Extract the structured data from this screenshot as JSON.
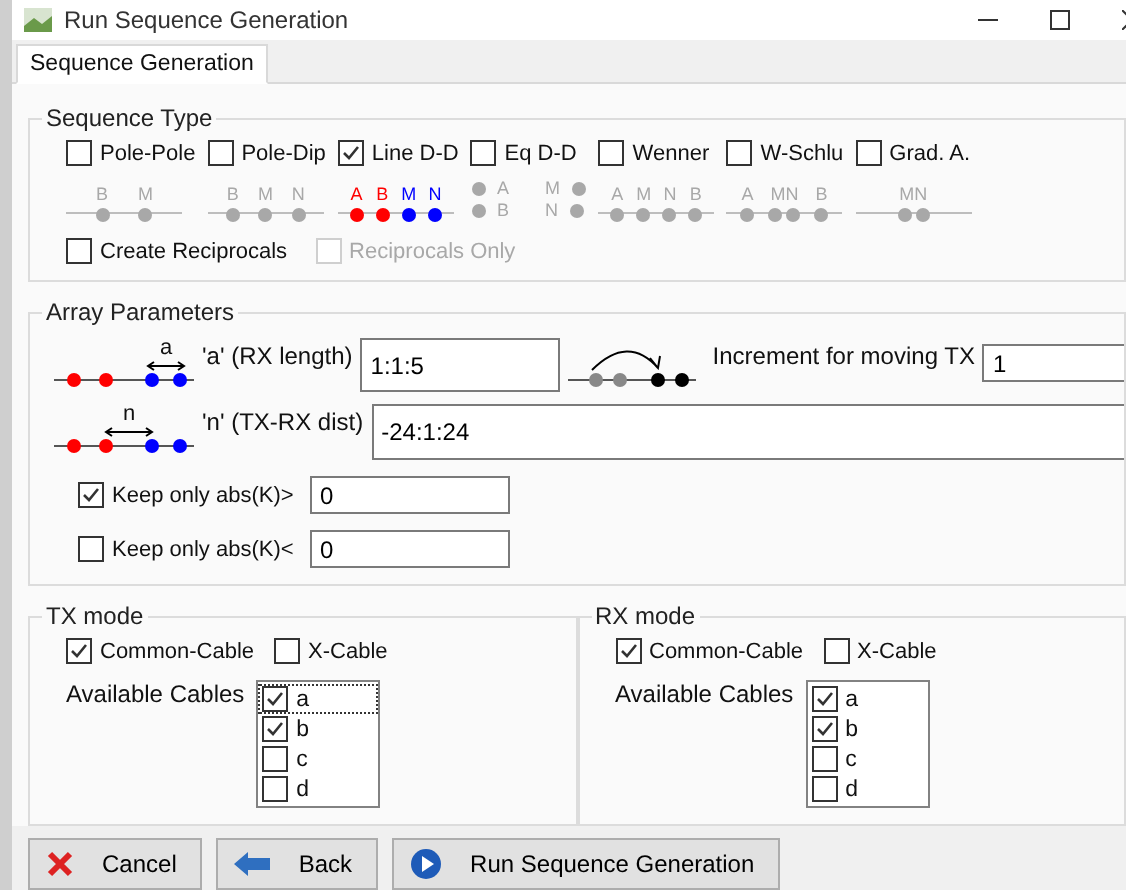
{
  "window": {
    "title": "Run Sequence Generation"
  },
  "tabs": [
    {
      "label": "Sequence Generation",
      "selected": true
    }
  ],
  "sequence_type": {
    "title": "Sequence Type",
    "options": [
      {
        "label": "Pole-Pole",
        "checked": false,
        "diagram": {
          "kind": "line",
          "electrodes": [
            {
              "label": "B",
              "kind": "single",
              "color": "#a8a8a8"
            },
            {
              "label": "M",
              "kind": "single",
              "color": "#a8a8a8"
            }
          ]
        }
      },
      {
        "label": "Pole-Dip",
        "checked": false,
        "diagram": {
          "kind": "line",
          "electrodes": [
            {
              "label": "B",
              "kind": "single",
              "color": "#a8a8a8"
            },
            {
              "label": "M",
              "kind": "single",
              "color": "#a8a8a8"
            },
            {
              "label": "N",
              "kind": "single",
              "color": "#a8a8a8"
            }
          ]
        }
      },
      {
        "label": "Line D-D",
        "checked": true,
        "diagram": {
          "kind": "line",
          "electrodes": [
            {
              "label": "A",
              "kind": "single",
              "color": "#ff0000"
            },
            {
              "label": "B",
              "kind": "single",
              "color": "#ff0000"
            },
            {
              "label": "M",
              "kind": "single",
              "color": "#0000ff"
            },
            {
              "label": "N",
              "kind": "single",
              "color": "#0000ff"
            }
          ]
        }
      },
      {
        "label": "Eq D-D",
        "checked": false,
        "diagram": {
          "kind": "stacked",
          "electrodes": [
            {
              "label": "A",
              "kind": "dot-left",
              "color": "#a8a8a8"
            },
            {
              "label": "B",
              "kind": "dot-left",
              "color": "#a8a8a8"
            },
            {
              "label": "M",
              "kind": "dot-right",
              "color": "#a8a8a8"
            },
            {
              "label": "N",
              "kind": "dot-right",
              "color": "#a8a8a8"
            }
          ]
        }
      },
      {
        "label": "Wenner",
        "checked": false,
        "diagram": {
          "kind": "line",
          "electrodes": [
            {
              "label": "A",
              "kind": "single",
              "color": "#a8a8a8"
            },
            {
              "label": "M",
              "kind": "single",
              "color": "#a8a8a8"
            },
            {
              "label": "N",
              "kind": "single",
              "color": "#a8a8a8"
            },
            {
              "label": "B",
              "kind": "single",
              "color": "#a8a8a8"
            }
          ]
        }
      },
      {
        "label": "W-Schlu",
        "checked": false,
        "diagram": {
          "kind": "line",
          "electrodes": [
            {
              "label": "A",
              "kind": "single",
              "color": "#a8a8a8"
            },
            {
              "label": "MN",
              "kind": "pair",
              "color": "#a8a8a8"
            },
            {
              "label": "B",
              "kind": "single",
              "color": "#a8a8a8"
            }
          ]
        }
      },
      {
        "label": "Grad. A.",
        "checked": false,
        "diagram": {
          "kind": "line",
          "electrodes": [
            {
              "label": "MN",
              "kind": "pair",
              "color": "#a8a8a8"
            }
          ]
        }
      }
    ],
    "reciprocals": [
      {
        "label": "Create Reciprocals",
        "checked": false,
        "disabled": false
      },
      {
        "label": "Reciprocals Only",
        "checked": false,
        "disabled": true
      }
    ]
  },
  "array_parameters": {
    "title": "Array Parameters",
    "a_length": {
      "label": "'a' (RX length)",
      "value": "1:1:5",
      "diagram_label": "a"
    },
    "increment": {
      "label": "Increment for moving TX",
      "value": "1"
    },
    "n_dist": {
      "label": "'n' (TX-RX dist)",
      "value": "-24:1:24",
      "diagram_label": "n"
    },
    "filters": [
      {
        "label": "Keep only abs(K)>",
        "checked": true,
        "value": "0"
      },
      {
        "label": "Keep only abs(K)<",
        "checked": false,
        "value": "0"
      }
    ]
  },
  "tx_mode": {
    "title": "TX mode",
    "options": [
      {
        "label": "Common-Cable",
        "checked": true
      },
      {
        "label": "X-Cable",
        "checked": false
      }
    ],
    "cables_label": "Available Cables",
    "cables": [
      {
        "label": "a",
        "checked": true,
        "selected": true
      },
      {
        "label": "b",
        "checked": true,
        "selected": false
      },
      {
        "label": "c",
        "checked": false,
        "selected": false
      },
      {
        "label": "d",
        "checked": false,
        "selected": false
      }
    ]
  },
  "rx_mode": {
    "title": "RX mode",
    "options": [
      {
        "label": "Common-Cable",
        "checked": true
      },
      {
        "label": "X-Cable",
        "checked": false
      }
    ],
    "cables_label": "Available Cables",
    "cables": [
      {
        "label": "a",
        "checked": true,
        "selected": false
      },
      {
        "label": "b",
        "checked": true,
        "selected": false
      },
      {
        "label": "c",
        "checked": false,
        "selected": false
      },
      {
        "label": "d",
        "checked": false,
        "selected": false
      }
    ]
  },
  "buttons": [
    {
      "label": "Cancel",
      "kind": "cancel"
    },
    {
      "label": "Back",
      "kind": "back"
    },
    {
      "label": "Run Sequence Generation",
      "kind": "run"
    }
  ]
}
